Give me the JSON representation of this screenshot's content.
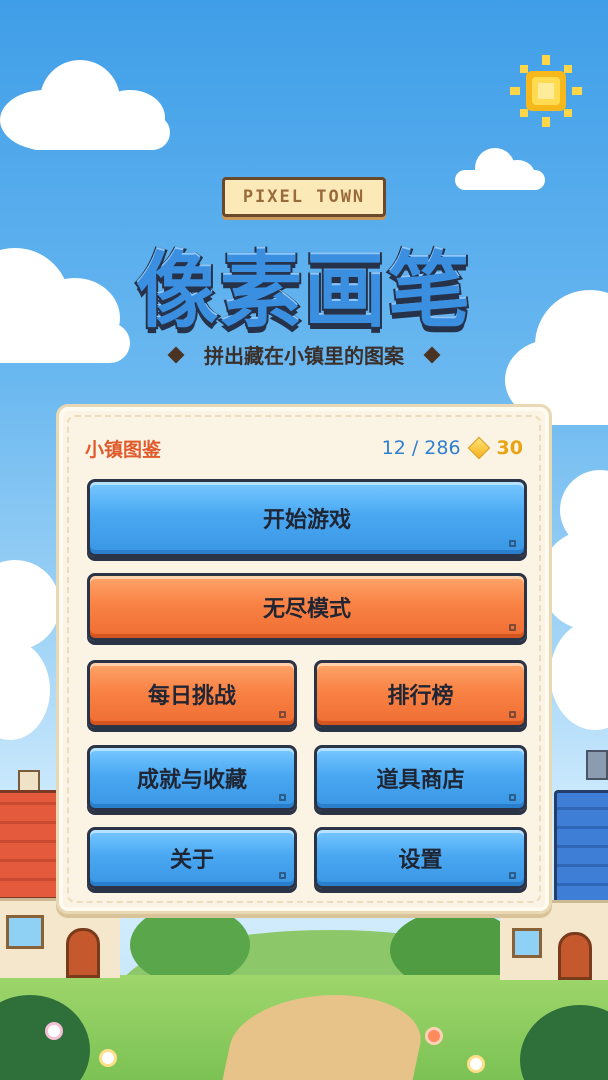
{
  "header": {
    "tag": "PIXEL TOWN",
    "title": "像素画笔",
    "subtitle": "拼出藏在小镇里的图案"
  },
  "panel": {
    "title": "小镇图鉴",
    "progress": "12 / 286",
    "coins": "30"
  },
  "buttons": {
    "start": "开始游戏",
    "endless": "无尽模式",
    "daily": "每日挑战",
    "leaderboard": "排行榜",
    "achievements": "成就与收藏",
    "shop": "道具商店",
    "about": "关于",
    "settings": "设置"
  },
  "colors": {
    "sky": "#4aa6ec",
    "button_blue": "#4aa8f2",
    "button_orange": "#f98245",
    "outline": "#2b3347",
    "panel": "#fbf4e4",
    "accent_red": "#e05a2c"
  },
  "icons": {
    "sun": "sun-icon",
    "coin": "diamond-coin-icon"
  }
}
